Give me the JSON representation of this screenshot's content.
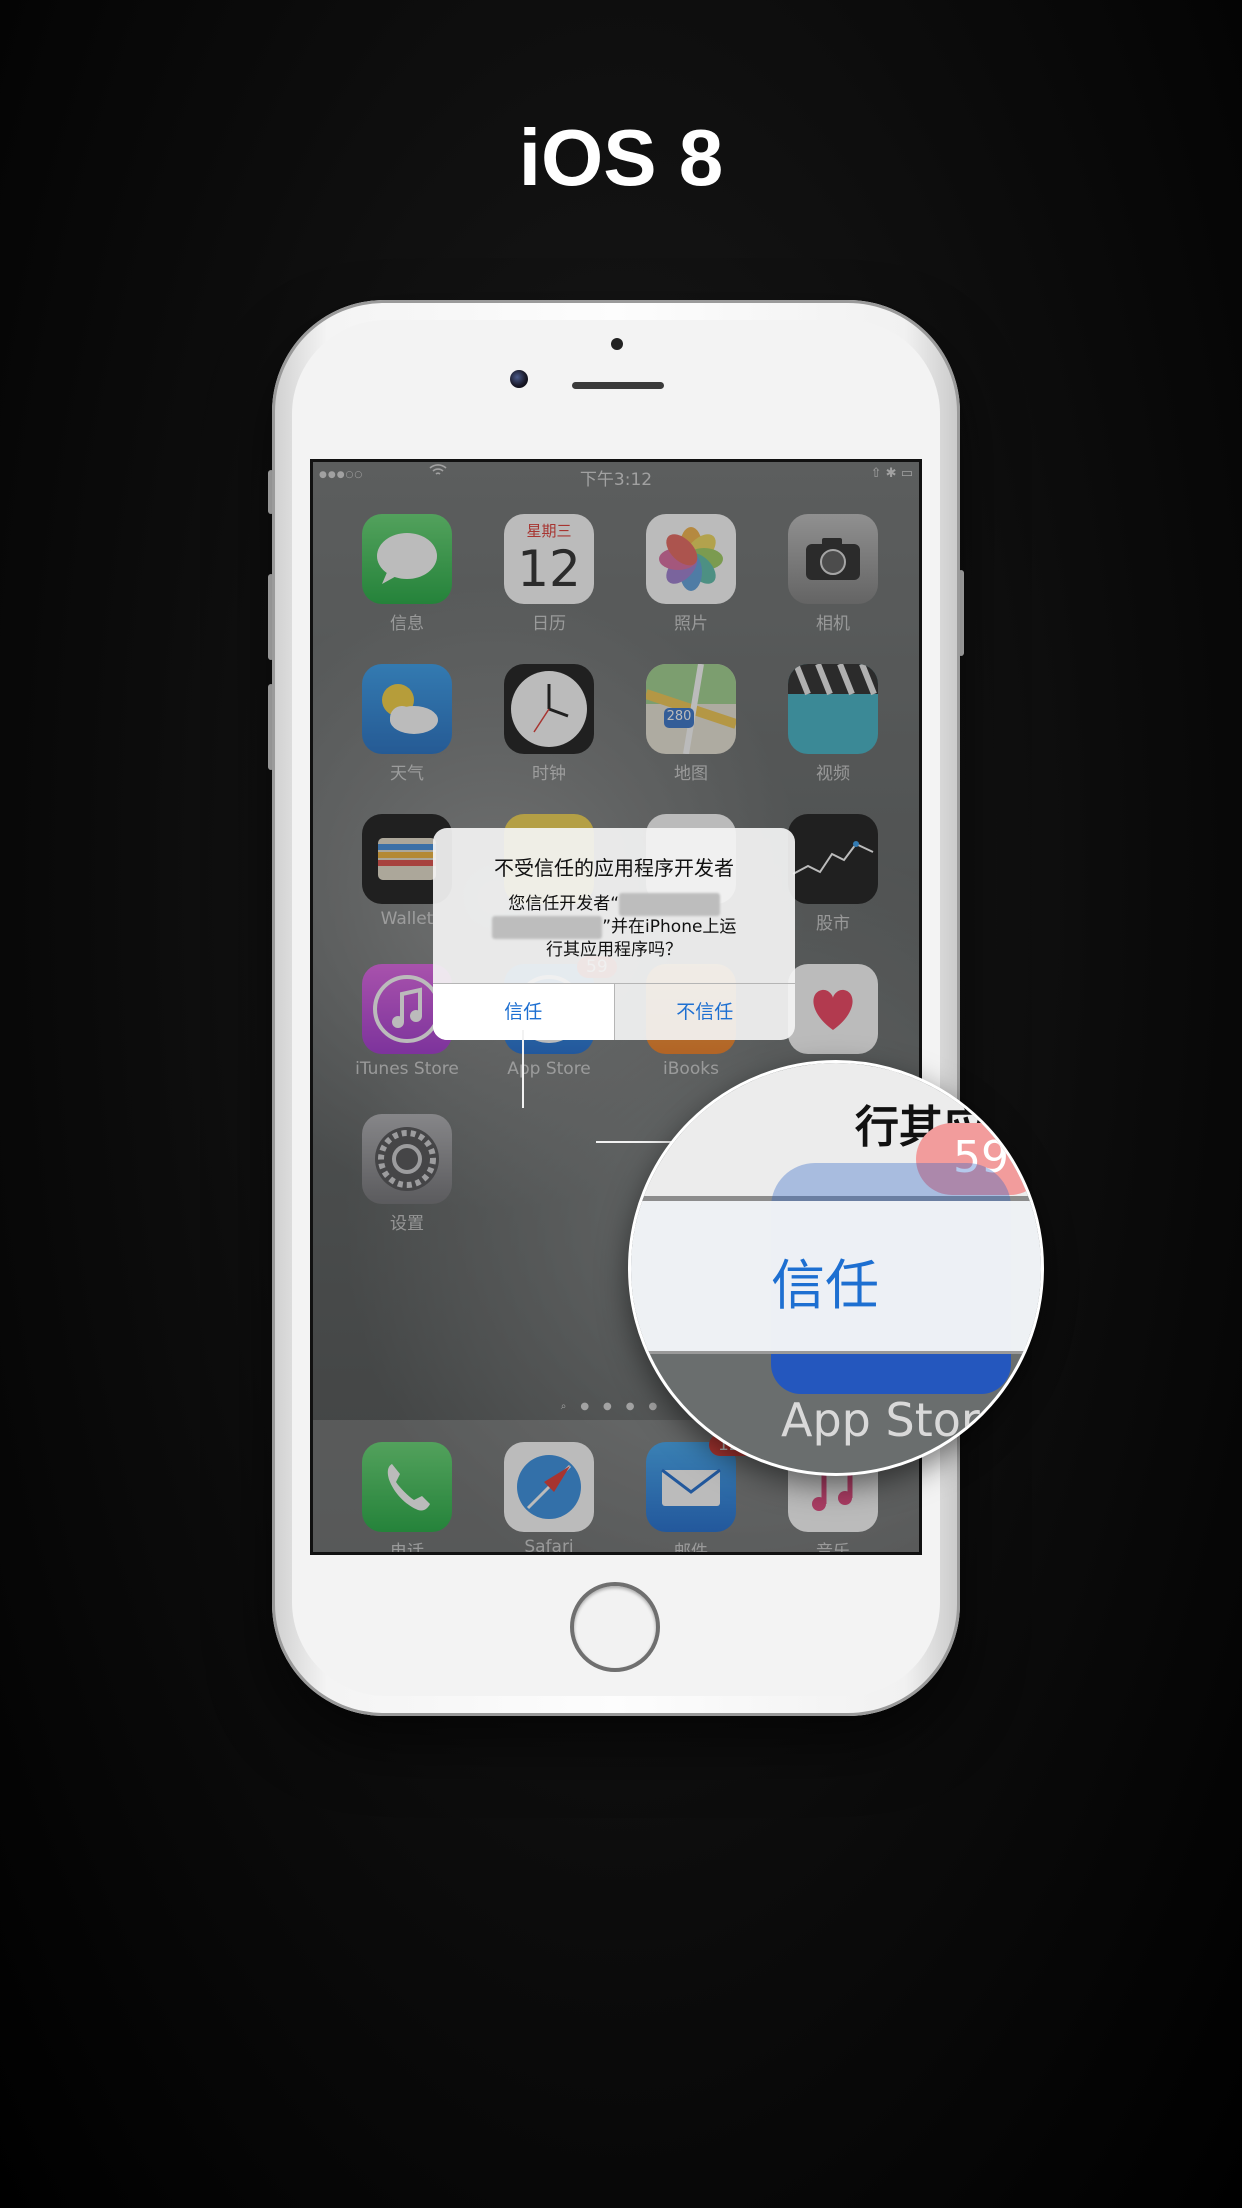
{
  "page_title": "iOS 8",
  "status_bar": {
    "signal": "●●●○○",
    "time": "下午3:12",
    "right": "⇧ ✱ ▭"
  },
  "apps": [
    {
      "label": "信息",
      "icon": "messages-icon",
      "color": "#2fb94a"
    },
    {
      "label": "日历",
      "icon": "calendar-icon",
      "color": "#ffffff",
      "weekday": "星期三",
      "day": "12"
    },
    {
      "label": "照片",
      "icon": "photos-icon",
      "color": "#ffffff"
    },
    {
      "label": "相机",
      "icon": "camera-icon",
      "color": "#8d8d8d"
    },
    {
      "label": "天气",
      "icon": "weather-icon",
      "color": "#2a8fe0"
    },
    {
      "label": "时钟",
      "icon": "clock-icon",
      "color": "#111111"
    },
    {
      "label": "地图",
      "icon": "maps-icon",
      "color": "#e9e3d6",
      "sign": "280"
    },
    {
      "label": "视频",
      "icon": "videos-icon",
      "color": "#3bb3c6"
    },
    {
      "label": "Wallet",
      "icon": "wallet-icon",
      "color": "#111111"
    },
    {
      "label": "",
      "icon": "notes-icon",
      "color": "#f4d44a"
    },
    {
      "label": "",
      "icon": "reminders-icon",
      "color": "#ffffff"
    },
    {
      "label": "股市",
      "icon": "stocks-icon",
      "color": "#111111"
    },
    {
      "label": "iTunes Store",
      "icon": "itunes-store-icon",
      "color": "#c63cd8"
    },
    {
      "label": "App Store",
      "icon": "app-store-icon",
      "color": "#1b8af0",
      "badge": "59"
    },
    {
      "label": "iBooks",
      "icon": "ibooks-icon",
      "color": "#f6921e"
    },
    {
      "label": "",
      "icon": "health-icon",
      "color": "#ffffff"
    },
    {
      "label": "设置",
      "icon": "settings-icon",
      "color": "#8e8e93"
    }
  ],
  "dock": [
    {
      "label": "电话",
      "icon": "phone-icon",
      "color": "#2fb94a"
    },
    {
      "label": "Safari",
      "icon": "safari-icon",
      "color": "#ffffff"
    },
    {
      "label": "邮件",
      "icon": "mail-icon",
      "color": "#1e88e5",
      "badge": "122"
    },
    {
      "label": "音乐",
      "icon": "music-icon",
      "color": "#ffffff"
    }
  ],
  "alert": {
    "title": "不受信任的应用程序开发者",
    "line1_prefix": "您信任开发者“",
    "line2_suffix": "”并在iPhone上运",
    "line3": "行其应用程序吗？",
    "trust_button": "信任",
    "distrust_button": "不信任"
  },
  "magnifier": {
    "fragment_text": "行其应",
    "badge": "59",
    "trust_label": "信任",
    "app_label": "App Store"
  }
}
